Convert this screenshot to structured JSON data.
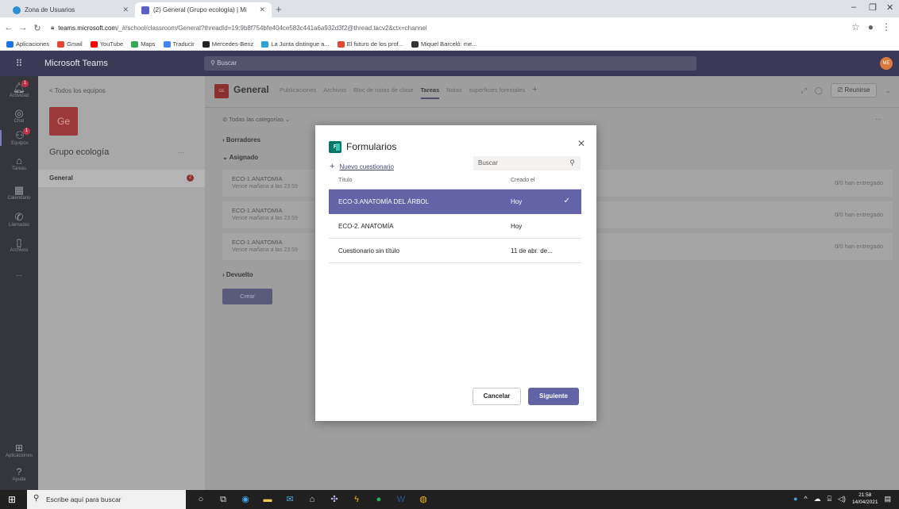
{
  "browser": {
    "tabs": [
      {
        "title": "Zona de Usuarios",
        "active": false
      },
      {
        "title": "(2) General (Grupo ecología) | Mi",
        "active": true
      }
    ],
    "url_host": "teams.microsoft.com",
    "url_path": "/_#/school/classroom/General?threadId=19:9b8f754bfe404ce583c441a6a932d3f2@thread.tacv2&ctx=channel",
    "bookmarks": [
      "Aplicaciones",
      "Gmail",
      "YouTube",
      "Maps",
      "Traducir",
      "Mercedes-Benz",
      "La Junta distingue a...",
      "El futuro de los prof...",
      "Miquel Barceló: me..."
    ]
  },
  "teams": {
    "app_name": "Microsoft Teams",
    "search_placeholder": "Buscar",
    "user_initials": "ME",
    "rail": [
      {
        "label": "Actividad",
        "icon": "bell-icon",
        "badge": "1"
      },
      {
        "label": "Chat",
        "icon": "chat-icon",
        "badge": ""
      },
      {
        "label": "Equipos",
        "icon": "teams-icon",
        "badge": "1"
      },
      {
        "label": "Tareas",
        "icon": "assignments-icon",
        "badge": ""
      },
      {
        "label": "Calendario",
        "icon": "calendar-icon",
        "badge": ""
      },
      {
        "label": "Llamadas",
        "icon": "phone-icon",
        "badge": ""
      },
      {
        "label": "Archivos",
        "icon": "file-icon",
        "badge": ""
      },
      {
        "label": "...",
        "icon": "more-icon",
        "badge": ""
      }
    ],
    "rail_bottom": [
      {
        "label": "Aplicaciones",
        "icon": "apps-icon"
      },
      {
        "label": "Ayuda",
        "icon": "help-icon"
      }
    ],
    "team_panel": {
      "back": "< Todos los equipos",
      "team_initials": "Ge",
      "team_name": "Grupo ecología",
      "more": "···",
      "channel": "General",
      "channel_badge": "2"
    },
    "channel": {
      "tile": "GE",
      "title": "General",
      "tabs": [
        "Publicaciones",
        "Archivos",
        "Bloc de notas de clase",
        "Tareas",
        "Notas",
        "superficies forestales"
      ],
      "active_tab": "Tareas",
      "meet": "Reunirse",
      "category_filter": "Todas las categorías",
      "sections": {
        "drafts": "Borradores",
        "assigned": "Asignado",
        "returned": "Devuelto"
      },
      "assignments": [
        {
          "title": "ECO-1.ANATOMIA",
          "due": "Vence mañana a las 23:59",
          "status": "0/0 han entregado"
        },
        {
          "title": "ECO-1.ANATOMIA",
          "due": "Vence mañana a las 23:59",
          "status": "0/0 han entregado"
        },
        {
          "title": "ECO-1.ANATOMIA",
          "due": "Vence mañana a las 23:59",
          "status": "0/0 han entregado"
        }
      ],
      "create": "Crear"
    }
  },
  "modal": {
    "logo": "F",
    "title": "Formularios",
    "new_form": "Nuevo cuestionario",
    "search_placeholder": "Buscar",
    "col_title": "Título",
    "col_created": "Creado el",
    "forms": [
      {
        "name": "ECO-3.ANATOMÍA DEL ÁRBOL",
        "created": "Hoy",
        "selected": true
      },
      {
        "name": "ECO-2. ANATOMÍA",
        "created": "Hoy",
        "selected": false
      },
      {
        "name": "Cuestionario sin título",
        "created": "11 de abr. de...",
        "selected": false
      }
    ],
    "cancel": "Cancelar",
    "next": "Siguiente"
  },
  "taskbar": {
    "search_placeholder": "Escribe aquí para buscar",
    "time": "21:58",
    "date": "14/04/2021"
  }
}
